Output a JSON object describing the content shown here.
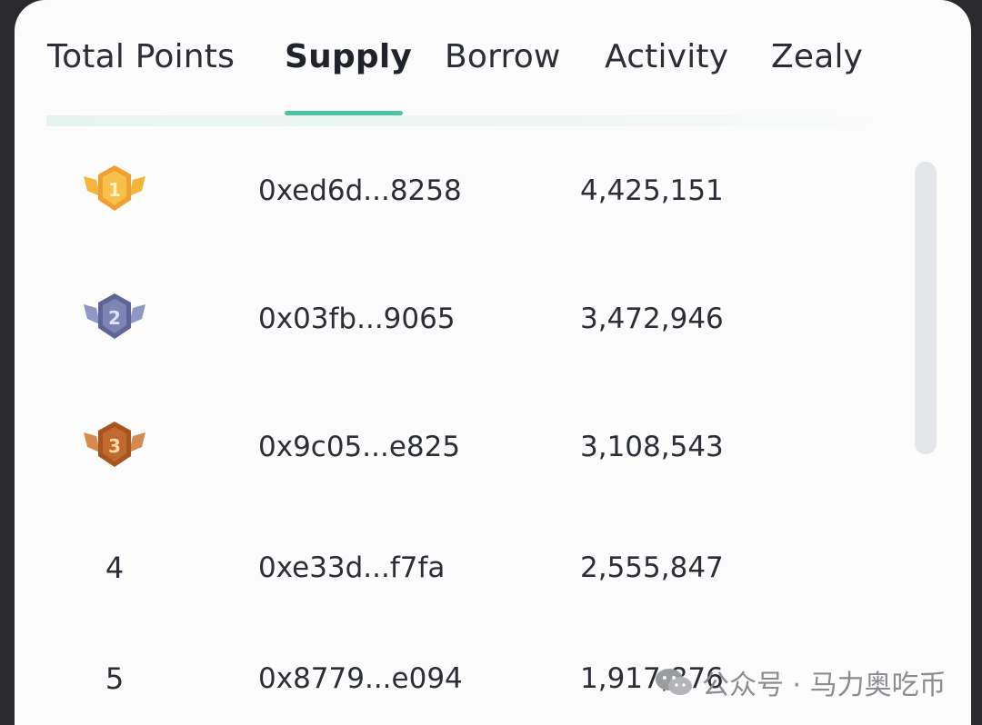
{
  "tabs": [
    {
      "label": "Total Points",
      "active": false
    },
    {
      "label": "Supply",
      "active": true
    },
    {
      "label": "Borrow",
      "active": false
    },
    {
      "label": "Activity",
      "active": false
    },
    {
      "label": "Zealy",
      "active": false
    }
  ],
  "leaderboard": [
    {
      "rank": "1",
      "address": "0xed6d...8258",
      "points": "4,425,151",
      "badge": "gold-badge-icon",
      "badge_color": "#f0a030"
    },
    {
      "rank": "2",
      "address": "0x03fb...9065",
      "points": "3,472,946",
      "badge": "silver-badge-icon",
      "badge_color": "#7d85b4"
    },
    {
      "rank": "3",
      "address": "0x9c05...e825",
      "points": "3,108,543",
      "badge": "bronze-badge-icon",
      "badge_color": "#c06a30"
    },
    {
      "rank": "4",
      "address": "0xe33d...f7fa",
      "points": "2,555,847"
    },
    {
      "rank": "5",
      "address": "0x8779...e094",
      "points": "1,917,876"
    }
  ],
  "colors": {
    "accent": "#4fc3a1",
    "text": "#2b2e35",
    "background": "#fcfcfd"
  },
  "watermark": {
    "text": "公众号 · 马力奥吃币",
    "icon": "wechat-icon"
  }
}
